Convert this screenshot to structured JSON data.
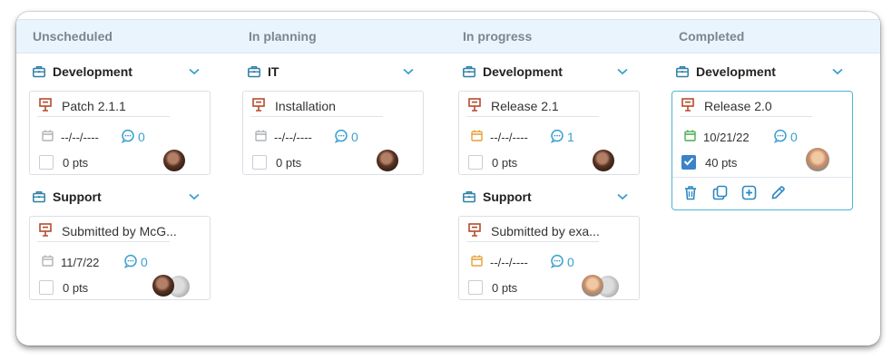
{
  "colors": {
    "header_bg": "#eaf4fc",
    "accent": "#3a9fcf",
    "briefcase": "#2f7fa6",
    "project_icon": "#b54a2a",
    "date_grey": "#b0b4b8",
    "date_orange": "#e6a23c",
    "date_green": "#4caf50",
    "check_on": "#3b82c8"
  },
  "columns": [
    {
      "title": "Unscheduled",
      "groups": [
        {
          "name": "Development",
          "cards": [
            {
              "title": "Patch 2.1.1",
              "date": "--/--/----",
              "date_icon": "calendar-grey",
              "comments": "0",
              "points": "0 pts",
              "checked": false,
              "avatars": [
                "dark"
              ]
            }
          ]
        },
        {
          "name": "Support",
          "cards": [
            {
              "title": "Submitted by McG...",
              "date": "11/7/22",
              "date_icon": "calendar-grey",
              "comments": "0",
              "points": "0 pts",
              "checked": false,
              "avatars": [
                "dark",
                "back"
              ]
            }
          ]
        }
      ]
    },
    {
      "title": "In planning",
      "groups": [
        {
          "name": "IT",
          "cards": [
            {
              "title": "Installation",
              "date": "--/--/----",
              "date_icon": "calendar-grey",
              "comments": "0",
              "points": "0 pts",
              "checked": false,
              "avatars": [
                "dark"
              ]
            }
          ]
        }
      ]
    },
    {
      "title": "In progress",
      "groups": [
        {
          "name": "Development",
          "cards": [
            {
              "title": "Release 2.1",
              "date": "--/--/----",
              "date_icon": "calendar-orange",
              "comments": "1",
              "points": "0 pts",
              "checked": false,
              "avatars": [
                "dark"
              ]
            }
          ]
        },
        {
          "name": "Support",
          "cards": [
            {
              "title": "Submitted by exa...",
              "date": "--/--/----",
              "date_icon": "calendar-orange",
              "comments": "0",
              "points": "0 pts",
              "checked": false,
              "avatars": [
                "light",
                "back"
              ]
            }
          ]
        }
      ]
    },
    {
      "title": "Completed",
      "groups": [
        {
          "name": "Development",
          "cards": [
            {
              "title": "Release 2.0",
              "date": "10/21/22",
              "date_icon": "calendar-green",
              "comments": "0",
              "points": "40 pts",
              "checked": true,
              "avatars": [
                "light"
              ],
              "actions": [
                "trash-icon",
                "copy-icon",
                "add-icon",
                "edit-icon"
              ]
            }
          ]
        }
      ]
    }
  ]
}
